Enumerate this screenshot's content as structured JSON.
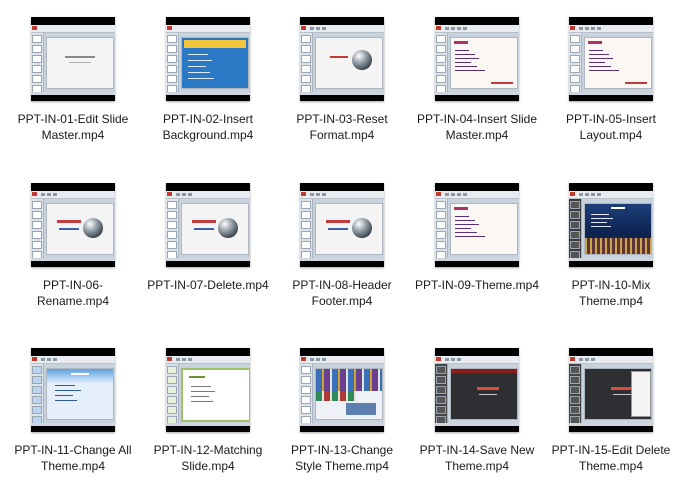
{
  "files": [
    {
      "name": "PPT-IN-01-Edit Slide Master.mp4",
      "thumbnail": "slide-master-title-icon"
    },
    {
      "name": "PPT-IN-02-Insert Background.mp4",
      "thumbnail": "background-agenda-icon"
    },
    {
      "name": "PPT-IN-03-Reset Format.mp4",
      "thumbnail": "globe-title-icon"
    },
    {
      "name": "PPT-IN-04-Insert Slide Master.mp4",
      "thumbnail": "agenda-slide-icon"
    },
    {
      "name": "PPT-IN-05-Insert Layout.mp4",
      "thumbnail": "agenda-slide-icon"
    },
    {
      "name": "PPT-IN-06-Rename.mp4",
      "thumbnail": "globe-title-icon"
    },
    {
      "name": "PPT-IN-07-Delete.mp4",
      "thumbnail": "globe-title-icon"
    },
    {
      "name": "PPT-IN-08-Header Footer.mp4",
      "thumbnail": "globe-title-icon"
    },
    {
      "name": "PPT-IN-09-Theme.mp4",
      "thumbnail": "agenda-slide-icon"
    },
    {
      "name": "PPT-IN-10-Mix Theme.mp4",
      "thumbnail": "city-night-agenda-icon"
    },
    {
      "name": "PPT-IN-11-Change All Theme.mp4",
      "thumbnail": "blue-theme-slide-icon"
    },
    {
      "name": "PPT-IN-12-Matching Slide.mp4",
      "thumbnail": "green-theme-slide-icon"
    },
    {
      "name": "PPT-IN-13-Change Style Theme.mp4",
      "thumbnail": "theme-gallery-icon"
    },
    {
      "name": "PPT-IN-14-Save New Theme.mp4",
      "thumbnail": "dark-theme-slide-icon"
    },
    {
      "name": "PPT-IN-15-Edit Delete Theme.mp4",
      "thumbnail": "dark-theme-menu-icon"
    }
  ]
}
